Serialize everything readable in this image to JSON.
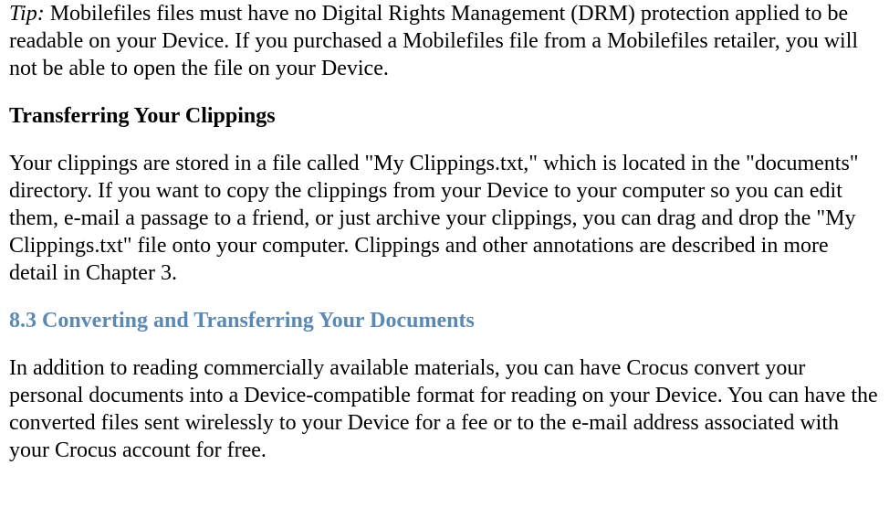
{
  "tip": {
    "label": "Tip:",
    "body": " Mobilefiles files must have no Digital Rights Management (DRM) protection applied to be readable on your Device. If you purchased a Mobilefiles file from a Mobilefiles retailer, you will not be able to open the file on your Device."
  },
  "clippings_heading": "Transferring Your Clippings",
  "clippings_body": "Your clippings are stored in a file called \"My Clippings.txt,\" which is located in the \"documents\" directory. If you want to copy the clippings from your Device to your computer so you can edit them, e-mail a passage to a friend, or just archive your clippings, you can drag and drop the \"My Clippings.txt\" file onto your computer. Clippings and other annotations are described in more detail in Chapter 3.",
  "section_heading": "8.3 Converting and Transferring Your Documents",
  "section_body": "In addition to reading commercially available materials, you can have Crocus convert your personal documents into a Device-compatible format for reading on your Device. You can have the converted files sent wirelessly to your Device for a fee or to the e-mail address associated with your Crocus account for free."
}
